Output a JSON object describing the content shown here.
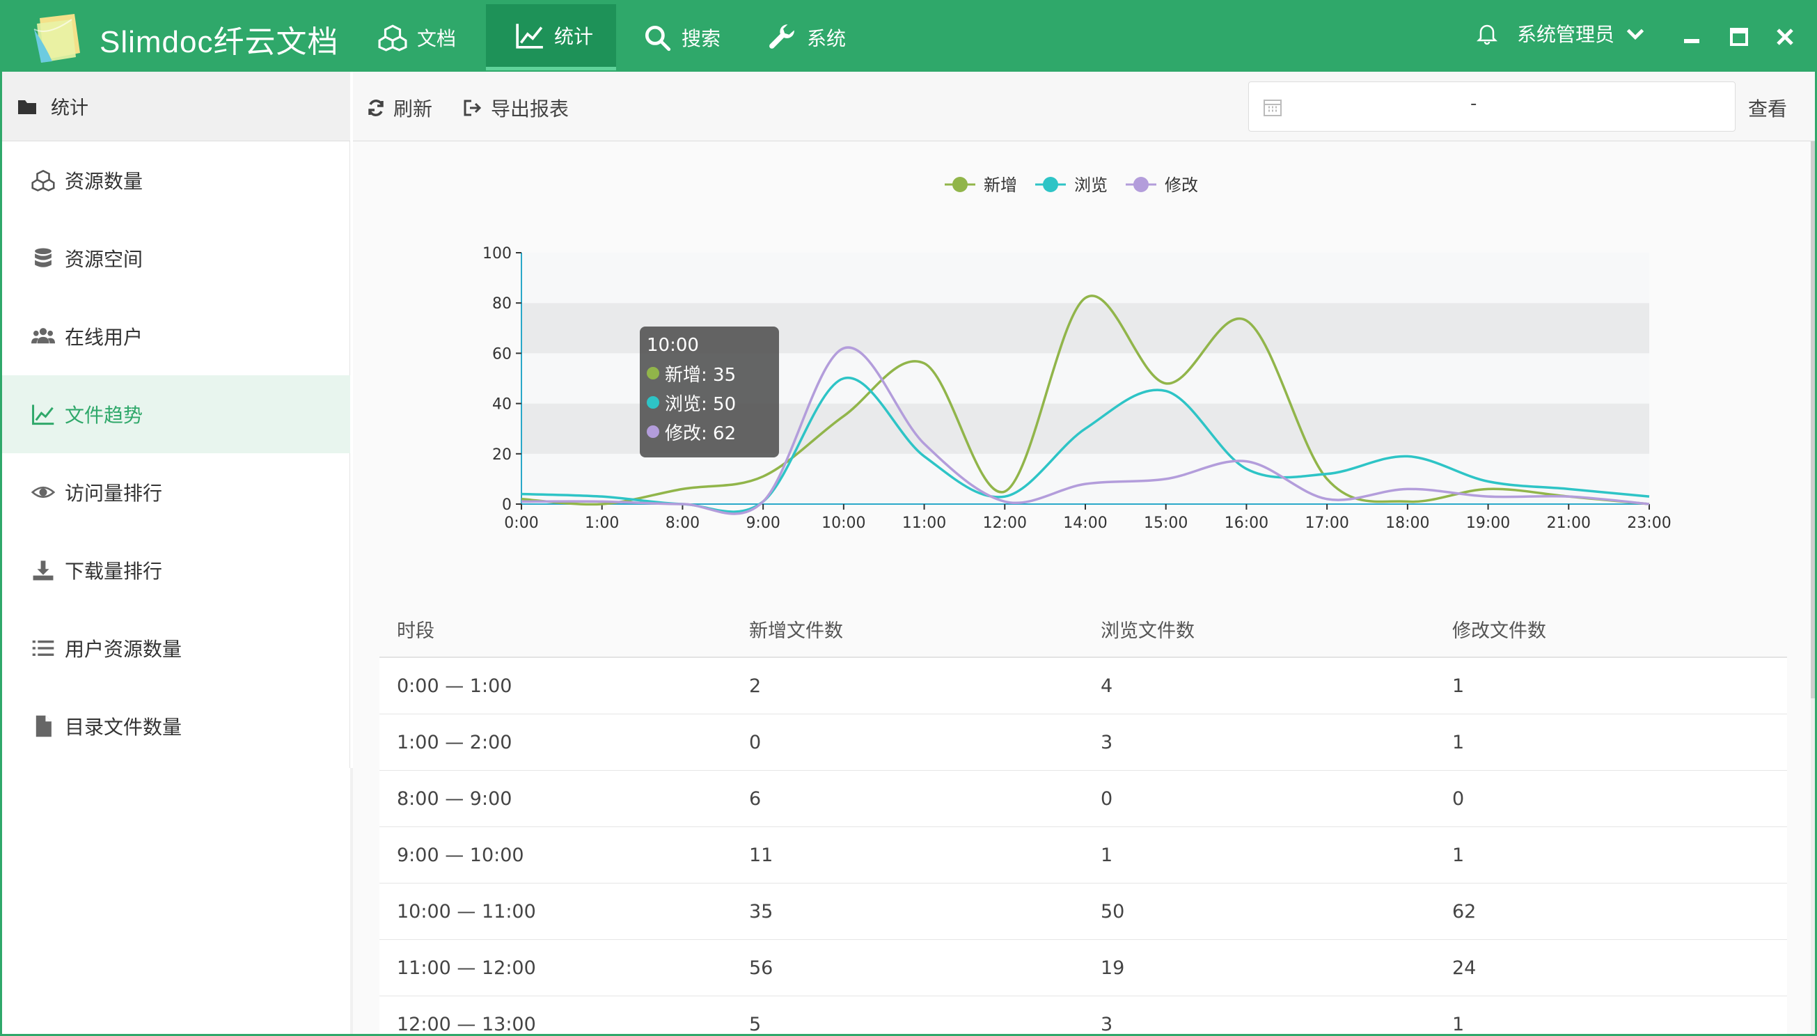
{
  "app": {
    "title": "Slimdoc纤云文档"
  },
  "nav": [
    {
      "label": "文档",
      "icon": "cubes-icon"
    },
    {
      "label": "统计",
      "icon": "line-chart-icon",
      "active": true
    },
    {
      "label": "搜索",
      "icon": "search-icon"
    },
    {
      "label": "系统",
      "icon": "wrench-icon"
    }
  ],
  "user": {
    "name": "系统管理员"
  },
  "sidebar": {
    "title": "统计",
    "items": [
      {
        "label": "资源数量",
        "icon": "cubes-icon"
      },
      {
        "label": "资源空间",
        "icon": "database-icon"
      },
      {
        "label": "在线用户",
        "icon": "users-icon"
      },
      {
        "label": "文件趋势",
        "icon": "line-chart-icon",
        "active": true
      },
      {
        "label": "访问量排行",
        "icon": "eye-icon"
      },
      {
        "label": "下载量排行",
        "icon": "download-icon"
      },
      {
        "label": "用户资源数量",
        "icon": "list-icon"
      },
      {
        "label": "目录文件数量",
        "icon": "file-icon"
      }
    ]
  },
  "toolbar": {
    "refresh_label": "刷新",
    "export_label": "导出报表",
    "date_separator": "-",
    "query_label": "查看"
  },
  "colors": {
    "brand": "#2fa86a",
    "added": "#91b54a",
    "viewed": "#2ec4c6",
    "modified": "#b39ddb"
  },
  "chart_data": {
    "type": "line",
    "x": [
      "0:00",
      "1:00",
      "8:00",
      "9:00",
      "10:00",
      "11:00",
      "12:00",
      "14:00",
      "15:00",
      "16:00",
      "17:00",
      "18:00",
      "19:00",
      "21:00",
      "23:00"
    ],
    "ylim": [
      0,
      100
    ],
    "yticks": [
      0,
      20,
      40,
      60,
      80,
      100
    ],
    "legend": "top-center",
    "series": [
      {
        "name": "新增",
        "values": [
          2,
          0,
          6,
          11,
          35,
          56,
          5,
          82,
          48,
          73,
          10,
          1,
          6,
          3,
          0
        ]
      },
      {
        "name": "浏览",
        "values": [
          4,
          3,
          0,
          1,
          50,
          19,
          3,
          30,
          45,
          14,
          12,
          19,
          9,
          6,
          3
        ]
      },
      {
        "name": "修改",
        "values": [
          1,
          1,
          0,
          1,
          62,
          24,
          1,
          8,
          10,
          17,
          2,
          6,
          3,
          3,
          0
        ]
      }
    ],
    "tooltip": {
      "title": "10:00",
      "rows": [
        "新增: 35",
        "浏览: 50",
        "修改: 62"
      ]
    }
  },
  "table": {
    "headers": [
      "时段",
      "新增文件数",
      "浏览文件数",
      "修改文件数"
    ],
    "rows": [
      [
        "0:00 — 1:00",
        "2",
        "4",
        "1"
      ],
      [
        "1:00 — 2:00",
        "0",
        "3",
        "1"
      ],
      [
        "8:00 — 9:00",
        "6",
        "0",
        "0"
      ],
      [
        "9:00 — 10:00",
        "11",
        "1",
        "1"
      ],
      [
        "10:00 — 11:00",
        "35",
        "50",
        "62"
      ],
      [
        "11:00 — 12:00",
        "56",
        "19",
        "24"
      ],
      [
        "12:00 — 13:00",
        "5",
        "3",
        "1"
      ]
    ]
  }
}
